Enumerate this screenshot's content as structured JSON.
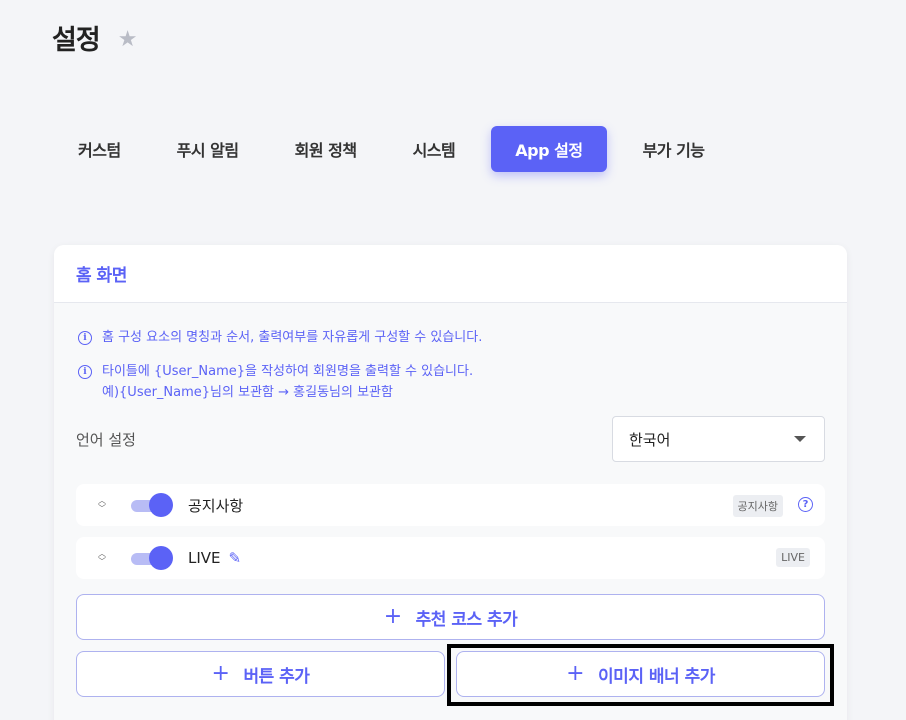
{
  "page": {
    "title": "설정",
    "star_icon": "star-icon"
  },
  "tabs": [
    {
      "label": "커스텀",
      "active": false
    },
    {
      "label": "푸시 알림",
      "active": false
    },
    {
      "label": "회원 정책",
      "active": false
    },
    {
      "label": "시스템",
      "active": false
    },
    {
      "label": "App 설정",
      "active": true
    },
    {
      "label": "부가 기능",
      "active": false
    }
  ],
  "card": {
    "title": "홈 화면",
    "info": [
      {
        "lines": [
          "홈 구성 요소의 명칭과 순서, 출력여부를 자유롭게 구성할 수 있습니다."
        ]
      },
      {
        "lines": [
          "타이틀에 {User_Name}을 작성하여 회원명을 출력할 수 있습니다.",
          "예){User_Name}님의 보관함 → 홍길동님의 보관함"
        ]
      }
    ],
    "language": {
      "label": "언어 설정",
      "selected": "한국어"
    },
    "rows": [
      {
        "label": "공지사항",
        "badge": "공지사항",
        "enabled": true
      },
      {
        "label": "LIVE",
        "badge": "LIVE",
        "enabled": true
      }
    ],
    "buttons": {
      "add_course": "추천 코스 추가",
      "add_button": "버튼 추가",
      "add_banner": "이미지 배너 추가"
    }
  },
  "colors": {
    "accent": "#5b62f6",
    "page_bg": "#f4f5f8"
  }
}
